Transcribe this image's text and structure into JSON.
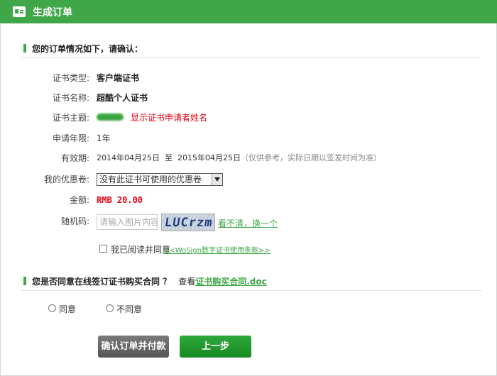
{
  "window": {
    "title": "生成订单"
  },
  "section1": {
    "heading": "您的订单情况如下，请确认："
  },
  "fields": {
    "cert_type": {
      "label": "证书类型:",
      "value": "客户端证书"
    },
    "cert_name": {
      "label": "证书名称:",
      "value": "超酷个人证书"
    },
    "cert_subject": {
      "label": "证书主题:",
      "note": "显示证书申请者姓名"
    },
    "term": {
      "label": "申请年限:",
      "value": "1年"
    },
    "validity": {
      "label": "有效期:",
      "value": "2014年04月25日  至  2015年04月25日",
      "note": "（仅供参考，实际日期以签发时间为准）"
    },
    "coupon": {
      "label": "我的优惠卷:",
      "selected": "没有此证书可使用的优惠卷"
    },
    "amount": {
      "label": "金额:",
      "value": "RMB 20.00"
    },
    "captcha": {
      "label": "随机码:",
      "placeholder": "请输入图片内容",
      "image_text": "LUCrzm",
      "refresh_link": "看不清，换一个"
    }
  },
  "agreement": {
    "text": "我已阅读并同意",
    "link": "<<WoSign数字证书使用条款>>"
  },
  "section2": {
    "heading": "您是否同意在线签订证书购买合同 ？",
    "view_prefix": "查看",
    "contract_link": "证书购买合同.doc"
  },
  "options": {
    "agree": "同意",
    "disagree": "不同意"
  },
  "buttons": {
    "confirm": "确认订单并付款",
    "back": "上一步"
  },
  "colors": {
    "accent": "#3fa748",
    "price": "#e60012"
  }
}
